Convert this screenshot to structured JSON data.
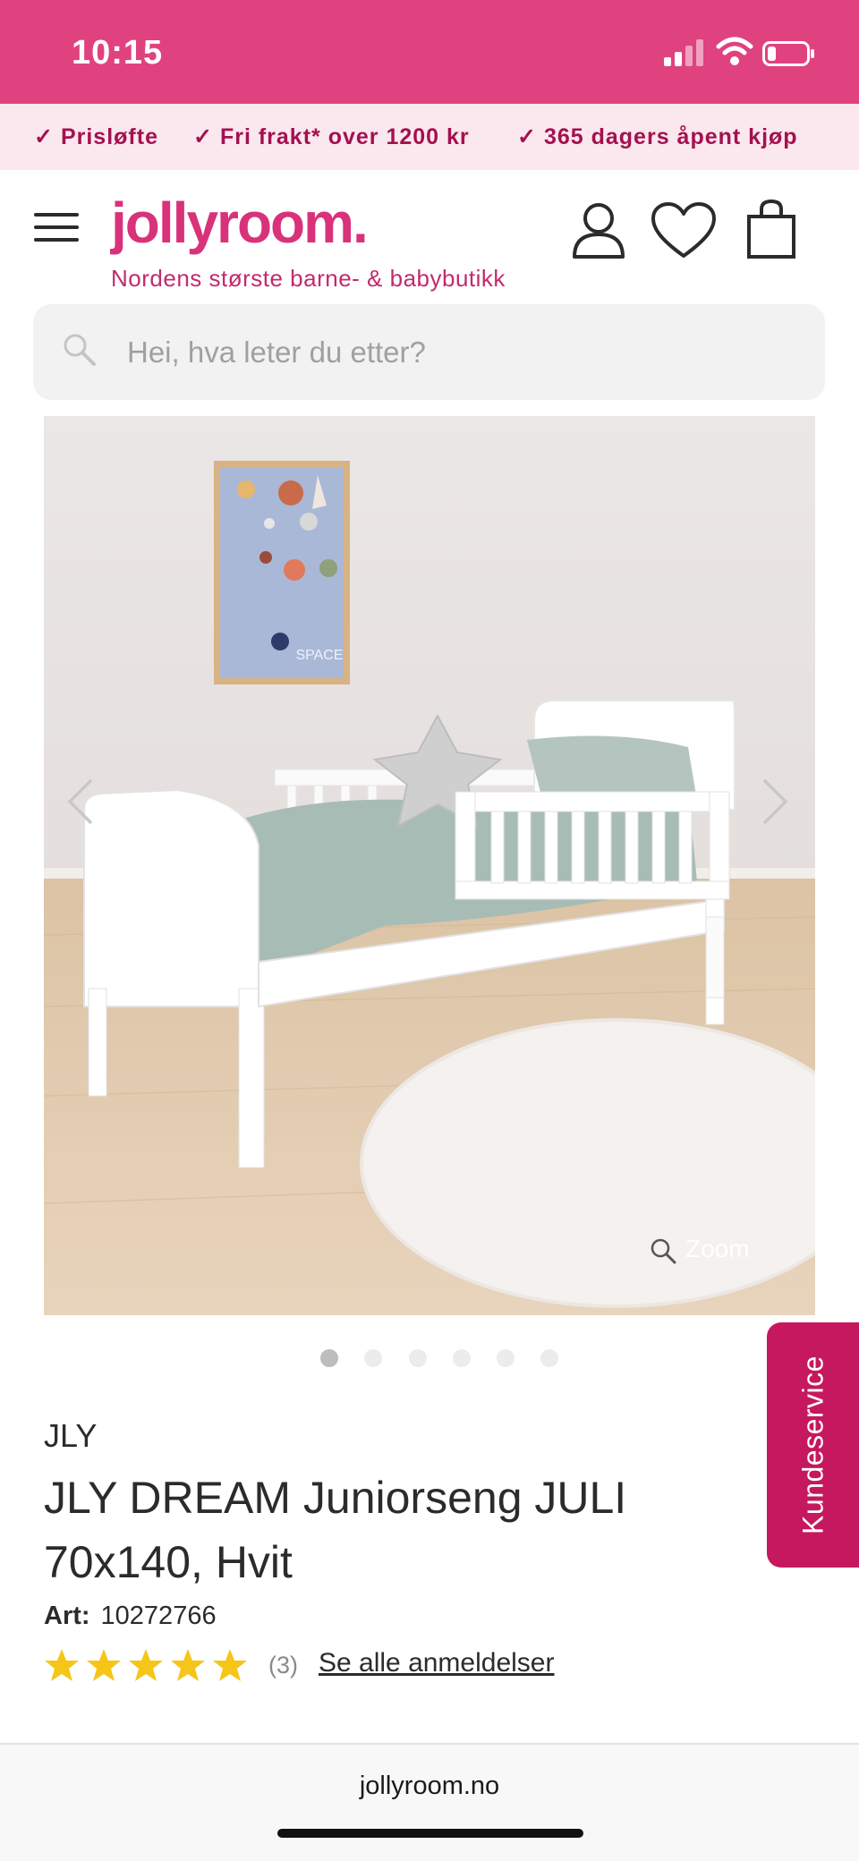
{
  "status_bar": {
    "time": "10:15"
  },
  "usp": [
    {
      "label": "Prisløfte"
    },
    {
      "label": "Fri frakt* over 1200 kr"
    },
    {
      "label": "365 dagers åpent kjøp"
    }
  ],
  "header": {
    "logo": "jollyroom.",
    "tagline": "Nordens største barne- & babybutikk"
  },
  "search": {
    "placeholder": "Hei, hva leter du etter?"
  },
  "gallery": {
    "zoom_label": "Zoom",
    "image_count": 6,
    "active_index": 0,
    "poster_text": "SPACE"
  },
  "product": {
    "brand": "JLY",
    "title": "JLY DREAM Juniorseng JULI 70x140, Hvit",
    "art_label": "Art:",
    "art_number": "10272766",
    "rating": 5,
    "review_count": "(3)",
    "reviews_link": "Se alle anmeldelser"
  },
  "floating": {
    "customer_service": "Kundeservice"
  },
  "browser": {
    "url": "jollyroom.no"
  },
  "colors": {
    "brand_pink": "#e0427f",
    "logo_pink": "#d8327a",
    "usp_text": "#a3114f",
    "star_yellow": "#f5c518",
    "service_tab": "#c5185f"
  }
}
